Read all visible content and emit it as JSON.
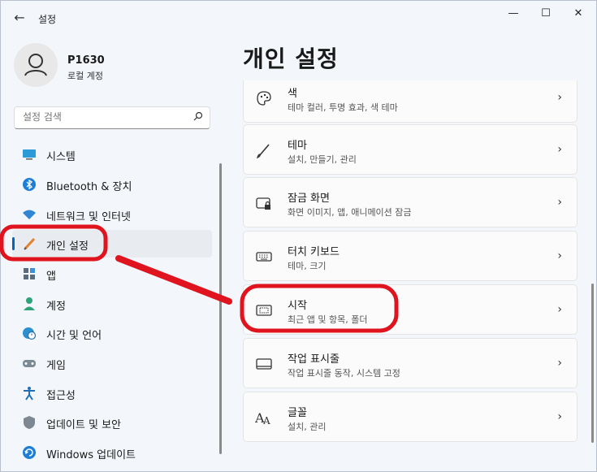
{
  "window": {
    "title": "설정",
    "back_icon": "arrow-left-icon",
    "controls": {
      "minimize": "—",
      "maximize": "☐",
      "close": "✕"
    }
  },
  "profile": {
    "name": "P1630",
    "account_type": "로컬 계정",
    "avatar_icon": "user-avatar-icon"
  },
  "search": {
    "placeholder": "설정 검색",
    "icon": "search-icon"
  },
  "sidebar": {
    "items": [
      {
        "label": "시스템",
        "icon": "monitor-icon",
        "active": false
      },
      {
        "label": "Bluetooth & 장치",
        "icon": "bluetooth-icon",
        "active": false
      },
      {
        "label": "네트워크 및 인터넷",
        "icon": "wifi-icon",
        "active": false
      },
      {
        "label": "개인 설정",
        "icon": "brush-icon",
        "active": true
      },
      {
        "label": "앱",
        "icon": "apps-icon",
        "active": false
      },
      {
        "label": "계정",
        "icon": "person-icon",
        "active": false
      },
      {
        "label": "시간 및 언어",
        "icon": "clock-globe-icon",
        "active": false
      },
      {
        "label": "게임",
        "icon": "gamepad-icon",
        "active": false
      },
      {
        "label": "접근성",
        "icon": "accessibility-icon",
        "active": false
      },
      {
        "label": "업데이트 및 보안",
        "icon": "shield-icon",
        "active": false
      },
      {
        "label": "Windows 업데이트",
        "icon": "update-icon",
        "active": false
      }
    ]
  },
  "main": {
    "title": "개인 설정",
    "cards": [
      {
        "title": "색",
        "subtitle": "테마 컬러, 투명 효과, 색 테마",
        "icon": "palette-icon"
      },
      {
        "title": "테마",
        "subtitle": "설치, 만들기, 관리",
        "icon": "brush-icon"
      },
      {
        "title": "잠금 화면",
        "subtitle": "화면 이미지, 앱, 애니메이션 잠금",
        "icon": "lock-screen-icon"
      },
      {
        "title": "터치 키보드",
        "subtitle": "테마, 크기",
        "icon": "keyboard-icon"
      },
      {
        "title": "시작",
        "subtitle": "최근 앱 및 항목, 폴더",
        "icon": "start-menu-icon"
      },
      {
        "title": "작업 표시줄",
        "subtitle": "작업 표시줄 동작, 시스템 고정",
        "icon": "taskbar-icon"
      },
      {
        "title": "글꼴",
        "subtitle": "설치, 관리",
        "icon": "font-icon"
      }
    ]
  },
  "colors": {
    "accent": "#0067c0",
    "annotation": "#e0141e"
  }
}
